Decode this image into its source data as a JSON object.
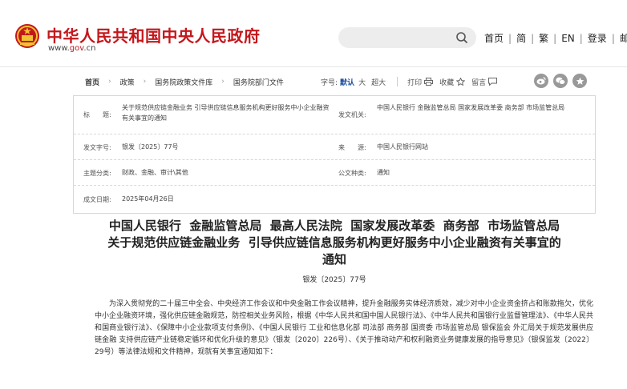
{
  "header": {
    "site_name": "中华人民共和国中央人民政府",
    "site_url_prefix": "www.",
    "site_url_gov": "gov",
    "site_url_suffix": ".cn",
    "search_placeholder": "",
    "nav": [
      "首页",
      "简",
      "繁",
      "EN",
      "登录",
      "邮箱"
    ],
    "brand_color": "#c4171c"
  },
  "breadcrumb": [
    "首页",
    "政策",
    "国务院政策文件库",
    "国务院部门文件"
  ],
  "tools": {
    "font_size_label": "字号:",
    "font_default": "默认",
    "font_large": "大",
    "font_xlarge": "超大",
    "print": "打印",
    "favorite": "收藏",
    "comment": "留言"
  },
  "share_icons": [
    "weibo-icon",
    "wechat-icon",
    "star-icon"
  ],
  "info": {
    "title_label": "标　　题:",
    "title_value": "关于规范供应链金融业务 引导供应链信息服务机构更好服务中小企业融资有关事宜的通知",
    "issuer_label": "发文机关:",
    "issuer_value": "中国人民银行 金融监管总局 国家发展改革委 商务部 市场监管总局",
    "doc_no_label": "发文字号:",
    "doc_no_value": "银发〔2025〕77号",
    "source_label": "来　　源:",
    "source_value": "中国人民银行网站",
    "topic_label": "主题分类:",
    "topic_value": "财政、金融、审计\\其他",
    "doctype_label": "公文种类:",
    "doctype_value": "通知",
    "date_label": "成文日期:",
    "date_value": "2025年04月26日"
  },
  "article": {
    "title_line1": "中国人民银行  金融监管总局  最高人民法院  国家发展改革委  商务部  市场监管总局",
    "title_line2": "关于规范供应链金融业务  引导供应链信息服务机构更好服务中小企业融资有关事宜的",
    "title_line3": "通知",
    "doc_number": "银发〔2025〕77号",
    "paragraph1": "为深入贯彻党的二十届三中全会、中央经济工作会议和中央金融工作会议精神，提升金融服务实体经济质效，减少对中小企业资金挤占和账款拖欠，优化中小企业融资环境，强化供应链金融规范，防控相关业务风险，根据《中华人民共和国中国人民银行法》、《中华人民共和国银行业监督管理法》、《中华人民共和国商业银行法》、《保障中小企业款项支付条例》、《中国人民银行 工业和信息化部 司法部 商务部 国资委 市场监管总局 银保监会 外汇局关于规范发展供应链金融 支持供应链产业链稳定循环和优化升级的意见》（银发〔2020〕226号）、《关于推动动产和权利融资业务健康发展的指导意见》（银保监发〔2022〕29号）等法律法规和文件精神，现就有关事宜通知如下："
  }
}
